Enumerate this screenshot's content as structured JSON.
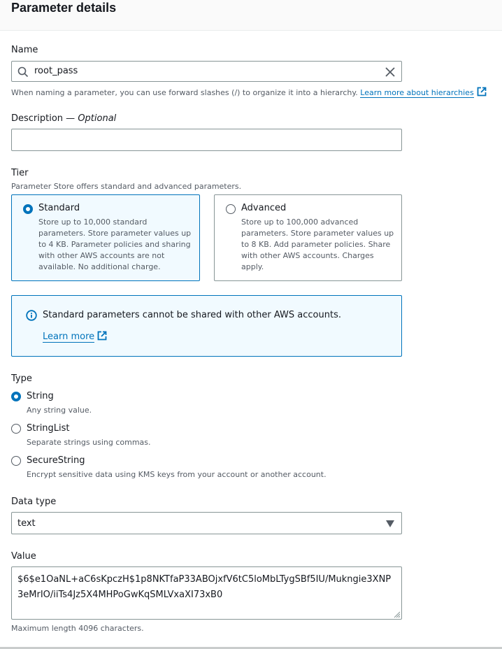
{
  "header": {
    "title": "Parameter details"
  },
  "name": {
    "label": "Name",
    "value": "root_pass",
    "hint": "When naming a parameter, you can use forward slashes (/) to organize it into a hierarchy.",
    "hint_link": "Learn more about hierarchies"
  },
  "description": {
    "label": "Description — ",
    "optional": "Optional",
    "value": ""
  },
  "tier": {
    "label": "Tier",
    "hint": "Parameter Store offers standard and advanced parameters.",
    "selected": "Standard",
    "options": [
      {
        "name": "Standard",
        "desc": "Store up to 10,000 standard parameters. Store parameter values up to 4 KB. Parameter policies and sharing with other AWS accounts are not available. No additional charge."
      },
      {
        "name": "Advanced",
        "desc": "Store up to 100,000 advanced parameters. Store parameter values up to 8 KB. Add parameter policies. Share with other AWS accounts. Charges apply."
      }
    ]
  },
  "alert": {
    "message": "Standard parameters cannot be shared with other AWS accounts.",
    "link": "Learn more"
  },
  "type": {
    "label": "Type",
    "selected": "String",
    "options": [
      {
        "name": "String",
        "desc": "Any string value."
      },
      {
        "name": "StringList",
        "desc": "Separate strings using commas."
      },
      {
        "name": "SecureString",
        "desc": "Encrypt sensitive data using KMS keys from your account or another account."
      }
    ]
  },
  "data_type": {
    "label": "Data type",
    "selected": "text"
  },
  "value": {
    "label": "Value",
    "text": "$6$e1OaNL+aC6sKpczH$1p8NKTfaP33ABOjxfV6tC5loMbLTygSBf5IU/Mukngie3XNP3eMrIO/iiTs4Jz5X4MHPoGwKqSMLVxaXI73xB0",
    "hint": "Maximum length 4096 characters."
  },
  "colors": {
    "accent": "#0073bb",
    "selected_bg": "#f1faff",
    "border": "#879596",
    "hint_text": "#545b64"
  }
}
